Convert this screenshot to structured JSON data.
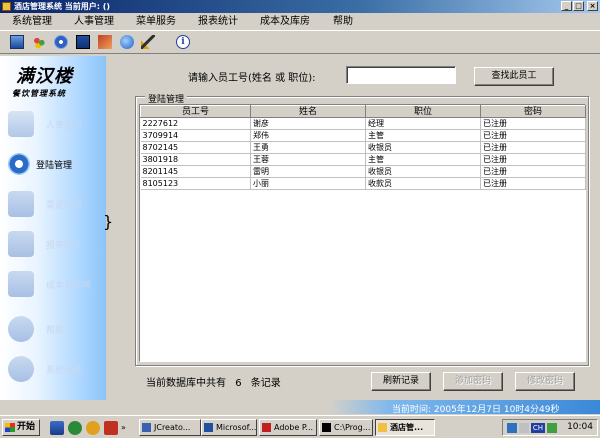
{
  "window": {
    "title": "酒店管理系统 当前用户: ()"
  },
  "menu": [
    "系统管理",
    "人事管理",
    "菜单服务",
    "报表统计",
    "成本及库房",
    "帮助"
  ],
  "toolbar_icons": [
    "computer-icon",
    "users-icon",
    "gear-icon",
    "book-icon",
    "card-icon",
    "globe-icon",
    "brush-icon",
    "info-icon"
  ],
  "sidebar": {
    "logo": "满汉楼",
    "subtitle": "餐饮管理系统",
    "items": [
      {
        "label": "人事登记",
        "icon": "person-icon"
      },
      {
        "label": "登陆管理",
        "icon": "disc-icon",
        "active": true
      },
      {
        "label": "菜谱价格",
        "icon": "fish-icon"
      },
      {
        "label": "报表统计",
        "icon": "chart-icon"
      },
      {
        "label": "成本及库房",
        "icon": "tools-icon"
      },
      {
        "label": "帮助",
        "icon": "help-icon"
      },
      {
        "label": "系统设置",
        "icon": "info-icon"
      }
    ]
  },
  "search": {
    "label": "请输入员工号(姓名 或 职位):",
    "value": "",
    "button": "查找此员工"
  },
  "group": {
    "title": "登陆管理"
  },
  "table": {
    "columns": [
      "员工号",
      "姓名",
      "职位",
      "密码"
    ],
    "rows": [
      [
        "2227612",
        "谢彦",
        "经理",
        "已注册"
      ],
      [
        "3709914",
        "郑伟",
        "主管",
        "已注册"
      ],
      [
        "8702145",
        "王勇",
        "收银员",
        "已注册"
      ],
      [
        "3801918",
        "王蓉",
        "主管",
        "已注册"
      ],
      [
        "8201145",
        "雷明",
        "收银员",
        "已注册"
      ],
      [
        "8105123",
        "小丽",
        "收款员",
        "已注册"
      ]
    ]
  },
  "footer": {
    "record_prefix": "当前数据库中共有",
    "record_count": "6",
    "record_suffix": "条记录",
    "refresh": "刷新记录",
    "add_password": "添加密码",
    "modify_password": "修改密码"
  },
  "status": {
    "text": "当前时间: 2005年12月7日 10时4分49秒"
  },
  "taskbar": {
    "start": "开始",
    "tasks": [
      "JCreato...",
      "Microsof...",
      "Adobe P...",
      "C:\\Prog...",
      "酒店管..."
    ],
    "lang": "CH",
    "clock": "10:04"
  },
  "colors": {
    "title_gradient_start": "#0a246a",
    "sidebar_blue": "#8cc4f8",
    "status_blue": "#3a88d8"
  }
}
